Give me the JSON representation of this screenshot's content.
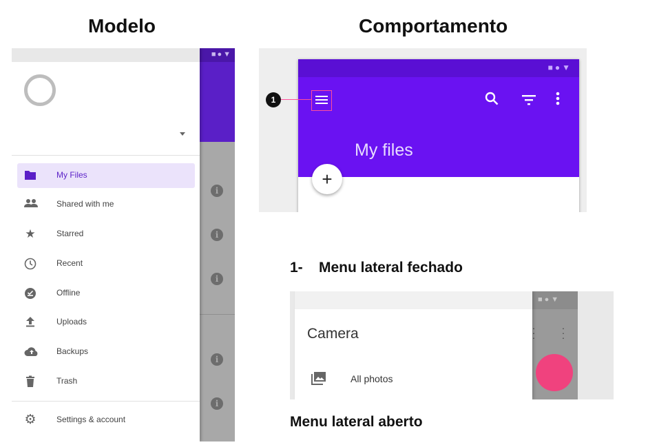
{
  "headings": {
    "model": "Modelo",
    "behavior": "Comportamento"
  },
  "drawer": {
    "nav_items": [
      {
        "label": "My Files",
        "icon": "folder-icon",
        "active": true
      },
      {
        "label": "Shared with me",
        "icon": "people-icon",
        "active": false
      },
      {
        "label": "Starred",
        "icon": "star-icon",
        "active": false
      },
      {
        "label": "Recent",
        "icon": "clock-icon",
        "active": false
      },
      {
        "label": "Offline",
        "icon": "offline-check-icon",
        "active": false
      },
      {
        "label": "Uploads",
        "icon": "upload-icon",
        "active": false
      },
      {
        "label": "Backups",
        "icon": "cloud-upload-icon",
        "active": false
      },
      {
        "label": "Trash",
        "icon": "trash-icon",
        "active": false
      }
    ],
    "footer_item": {
      "label": "Settings & account",
      "icon": "gear-icon"
    }
  },
  "behavior_demo": {
    "title": "My files",
    "callout_number": "1",
    "toolbar_icons": [
      "menu-icon",
      "search-icon",
      "filter-icon",
      "more-vert-icon"
    ]
  },
  "captions": {
    "closed": "1-    Menu lateral fechado",
    "opened": "Menu lateral aberto"
  },
  "opened_demo": {
    "title": "Camera",
    "item_label": "All photos"
  },
  "colors": {
    "accent_purple": "#6a12f2",
    "active_item_bg": "#ebe3fb",
    "fab_pink": "#f0427e",
    "callout_line": "#ff4f9a"
  }
}
